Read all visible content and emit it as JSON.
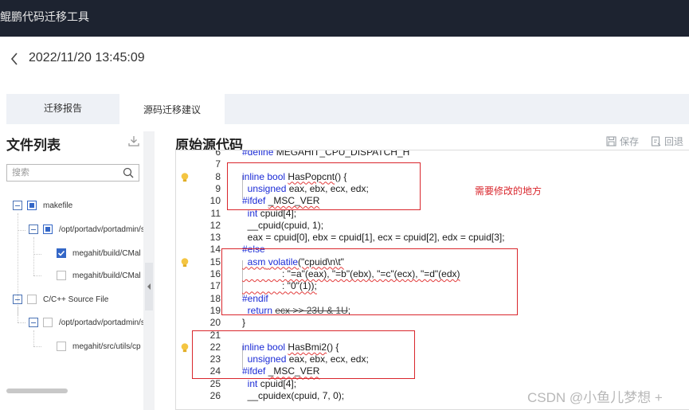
{
  "app": {
    "title": "鲲鹏代码迁移工具"
  },
  "header": {
    "timestamp": "2022/11/20 13:45:09"
  },
  "tabs": [
    {
      "label": "迁移报告",
      "active": false
    },
    {
      "label": "源码迁移建议",
      "active": true
    }
  ],
  "sidebar": {
    "title": "文件列表",
    "search_placeholder": "搜索",
    "tree": [
      {
        "label": "makefile",
        "level": 0,
        "state": "partial"
      },
      {
        "label": "/opt/portadv/portadmin/s",
        "level": 1,
        "state": "partial"
      },
      {
        "label": "megahit/build/CMal",
        "level": 2,
        "state": "checked"
      },
      {
        "label": "megahit/build/CMal",
        "level": 2,
        "state": "unchecked"
      },
      {
        "label": "C/C++ Source File",
        "level": 0,
        "state": "unchecked"
      },
      {
        "label": "/opt/portadv/portadmin/s",
        "level": 1,
        "state": "unchecked"
      },
      {
        "label": "megahit/src/utils/cp",
        "level": 2,
        "state": "unchecked"
      }
    ]
  },
  "code_panel": {
    "title": "原始源代码",
    "save_label": "保存",
    "back_label": "回退",
    "lines": [
      {
        "num": "6",
        "text": "#define MEGAHIT_CPU_DISPATCH_H"
      },
      {
        "num": "7",
        "text": ""
      },
      {
        "num": "8",
        "text": "inline bool HasPopcnt() {",
        "bulb": true
      },
      {
        "num": "9",
        "text": "  unsigned eax, ebx, ecx, edx;"
      },
      {
        "num": "10",
        "text": "#ifdef _MSC_VER"
      },
      {
        "num": "11",
        "text": "  int cpuid[4];"
      },
      {
        "num": "12",
        "text": "  __cpuid(cpuid, 1);"
      },
      {
        "num": "13",
        "text": "  eax = cpuid[0], ebx = cpuid[1], ecx = cpuid[2], edx = cpuid[3];"
      },
      {
        "num": "14",
        "text": "#else"
      },
      {
        "num": "15",
        "text": "  asm volatile(\"cpuid\\n\\t\"",
        "bulb": true
      },
      {
        "num": "16",
        "text": "               : \"=a\"(eax), \"=b\"(ebx), \"=c\"(ecx), \"=d\"(edx)"
      },
      {
        "num": "17",
        "text": "               : \"0\"(1));"
      },
      {
        "num": "18",
        "text": "#endif"
      },
      {
        "num": "19",
        "text": "  return ecx >> 23U & 1U;"
      },
      {
        "num": "20",
        "text": "}"
      },
      {
        "num": "21",
        "text": ""
      },
      {
        "num": "22",
        "text": "inline bool HasBmi2() {",
        "bulb": true
      },
      {
        "num": "23",
        "text": "  unsigned eax, ebx, ecx, edx;"
      },
      {
        "num": "24",
        "text": "#ifdef _MSC_VER"
      },
      {
        "num": "25",
        "text": "  int cpuid[4];"
      },
      {
        "num": "26",
        "text": "  __cpuidex(cpuid, 7, 0);"
      }
    ]
  },
  "annotation": {
    "text": "需要修改的地方"
  },
  "watermark": {
    "text": "CSDN @小鱼儿梦想 +"
  },
  "colors": {
    "topbar": "#1d2330",
    "accent": "#3467c7",
    "keyword": "#1b2bd6",
    "annotation": "#d9262c"
  }
}
